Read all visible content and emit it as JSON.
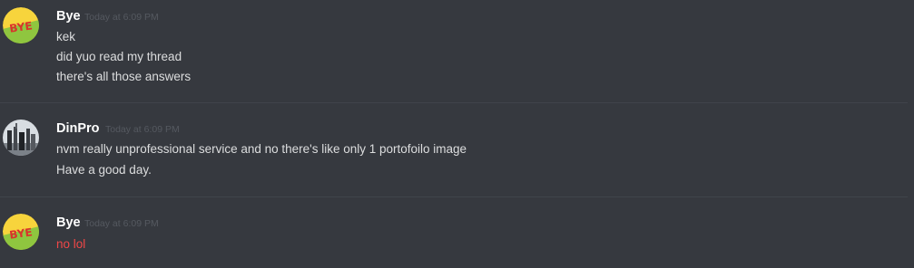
{
  "messages": [
    {
      "author": "Bye",
      "avatar_text": "BYE",
      "timestamp": "Today at 6:09 PM",
      "lines": [
        "kek",
        "did yuo read my thread",
        "there's all those answers"
      ]
    },
    {
      "author": "DinPro",
      "timestamp": "Today at 6:09 PM",
      "lines": [
        "nvm really unprofessional service and no there's like only 1 portofoilo image",
        "Have a good day."
      ]
    },
    {
      "author": "Bye",
      "avatar_text": "BYE",
      "timestamp": "Today at 6:09 PM",
      "lines": [
        "no lol"
      ]
    }
  ],
  "colors": {
    "background": "#36393f",
    "username": "#ffffff",
    "message_text": "#dcddde",
    "timestamp": "#555960",
    "alert_text": "#f04747",
    "bye_avatar_yellow": "#f7d43c",
    "bye_avatar_green": "#8fc63f"
  }
}
